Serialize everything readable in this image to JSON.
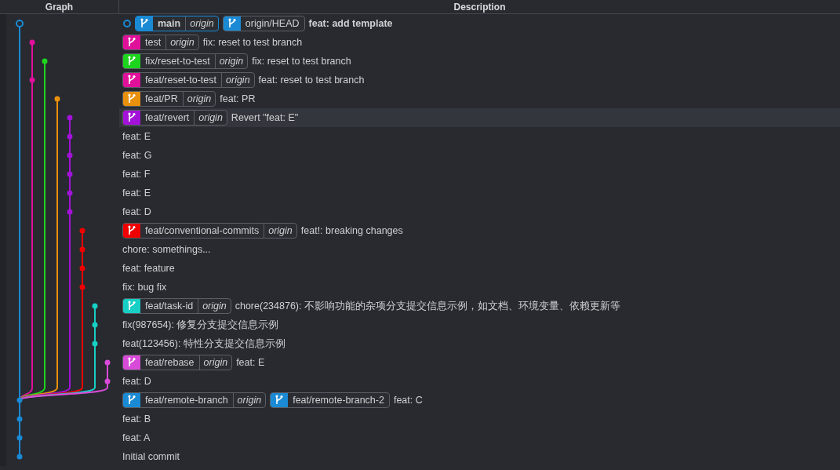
{
  "header": {
    "columns": [
      "Graph",
      "Description"
    ]
  },
  "commits": [
    {
      "message": "feat: add template",
      "color": "#1a8ad4",
      "current": true,
      "selected": false,
      "refs": [
        {
          "name": "main",
          "remote": "origin"
        },
        {
          "name": "origin/HEAD"
        }
      ]
    },
    {
      "message": "fix: reset to test branch",
      "color": "#e0109b",
      "current": false,
      "selected": false,
      "refs": [
        {
          "name": "test",
          "remote": "origin"
        }
      ]
    },
    {
      "message": "fix: reset to test branch",
      "color": "#1ed51e",
      "current": false,
      "selected": false,
      "refs": [
        {
          "name": "fix/reset-to-test",
          "remote": "origin"
        }
      ]
    },
    {
      "message": "feat: reset to test branch",
      "color": "#e0109b",
      "current": false,
      "selected": false,
      "refs": [
        {
          "name": "feat/reset-to-test",
          "remote": "origin"
        }
      ]
    },
    {
      "message": "feat: PR",
      "color": "#e8910c",
      "current": false,
      "selected": false,
      "refs": [
        {
          "name": "feat/PR",
          "remote": "origin"
        }
      ]
    },
    {
      "message": "Revert \"feat: E\"",
      "color": "#a212d8",
      "current": false,
      "selected": true,
      "refs": [
        {
          "name": "feat/revert",
          "remote": "origin"
        }
      ]
    },
    {
      "message": "feat: E",
      "color": "#a212d8",
      "current": false,
      "selected": false
    },
    {
      "message": "feat: G",
      "color": "#a212d8",
      "current": false,
      "selected": false
    },
    {
      "message": "feat: F",
      "color": "#a212d8",
      "current": false,
      "selected": false
    },
    {
      "message": "feat: E",
      "color": "#a212d8",
      "current": false,
      "selected": false
    },
    {
      "message": "feat: D",
      "color": "#a212d8",
      "current": false,
      "selected": false
    },
    {
      "message": "feat!: breaking changes",
      "color": "#f00000",
      "current": false,
      "selected": false,
      "refs": [
        {
          "name": "feat/conventional-commits",
          "remote": "origin"
        }
      ]
    },
    {
      "message": "chore: somethings...",
      "color": "#f00000",
      "current": false,
      "selected": false
    },
    {
      "message": "feat: feature",
      "color": "#f00000",
      "current": false,
      "selected": false
    },
    {
      "message": "fix: bug fix",
      "color": "#f00000",
      "current": false,
      "selected": false
    },
    {
      "message": "chore(234876): 不影响功能的杂项分支提交信息示例，如文档、环境变量、依赖更新等",
      "color": "#17cfc4",
      "current": false,
      "selected": false,
      "refs": [
        {
          "name": "feat/task-id",
          "remote": "origin"
        }
      ]
    },
    {
      "message": "fix(987654): 修复分支提交信息示例",
      "color": "#17cfc4",
      "current": false,
      "selected": false
    },
    {
      "message": "feat(123456): 特性分支提交信息示例",
      "color": "#17cfc4",
      "current": false,
      "selected": false
    },
    {
      "message": "feat: E",
      "color": "#d84ad8",
      "current": false,
      "selected": false,
      "refs": [
        {
          "name": "feat/rebase",
          "remote": "origin"
        }
      ]
    },
    {
      "message": "feat: D",
      "color": "#d84ad8",
      "current": false,
      "selected": false
    },
    {
      "message": "feat: C",
      "color": "#1a8ad4",
      "current": false,
      "selected": false,
      "refs": [
        {
          "name": "feat/remote-branch",
          "remote": "origin"
        },
        {
          "name": "feat/remote-branch-2"
        }
      ]
    },
    {
      "message": "feat: B",
      "color": "#1a8ad4",
      "current": false,
      "selected": false
    },
    {
      "message": "feat: A",
      "color": "#1a8ad4",
      "current": false,
      "selected": false
    },
    {
      "message": "Initial commit",
      "color": "#1a8ad4",
      "current": false,
      "selected": false
    }
  ]
}
